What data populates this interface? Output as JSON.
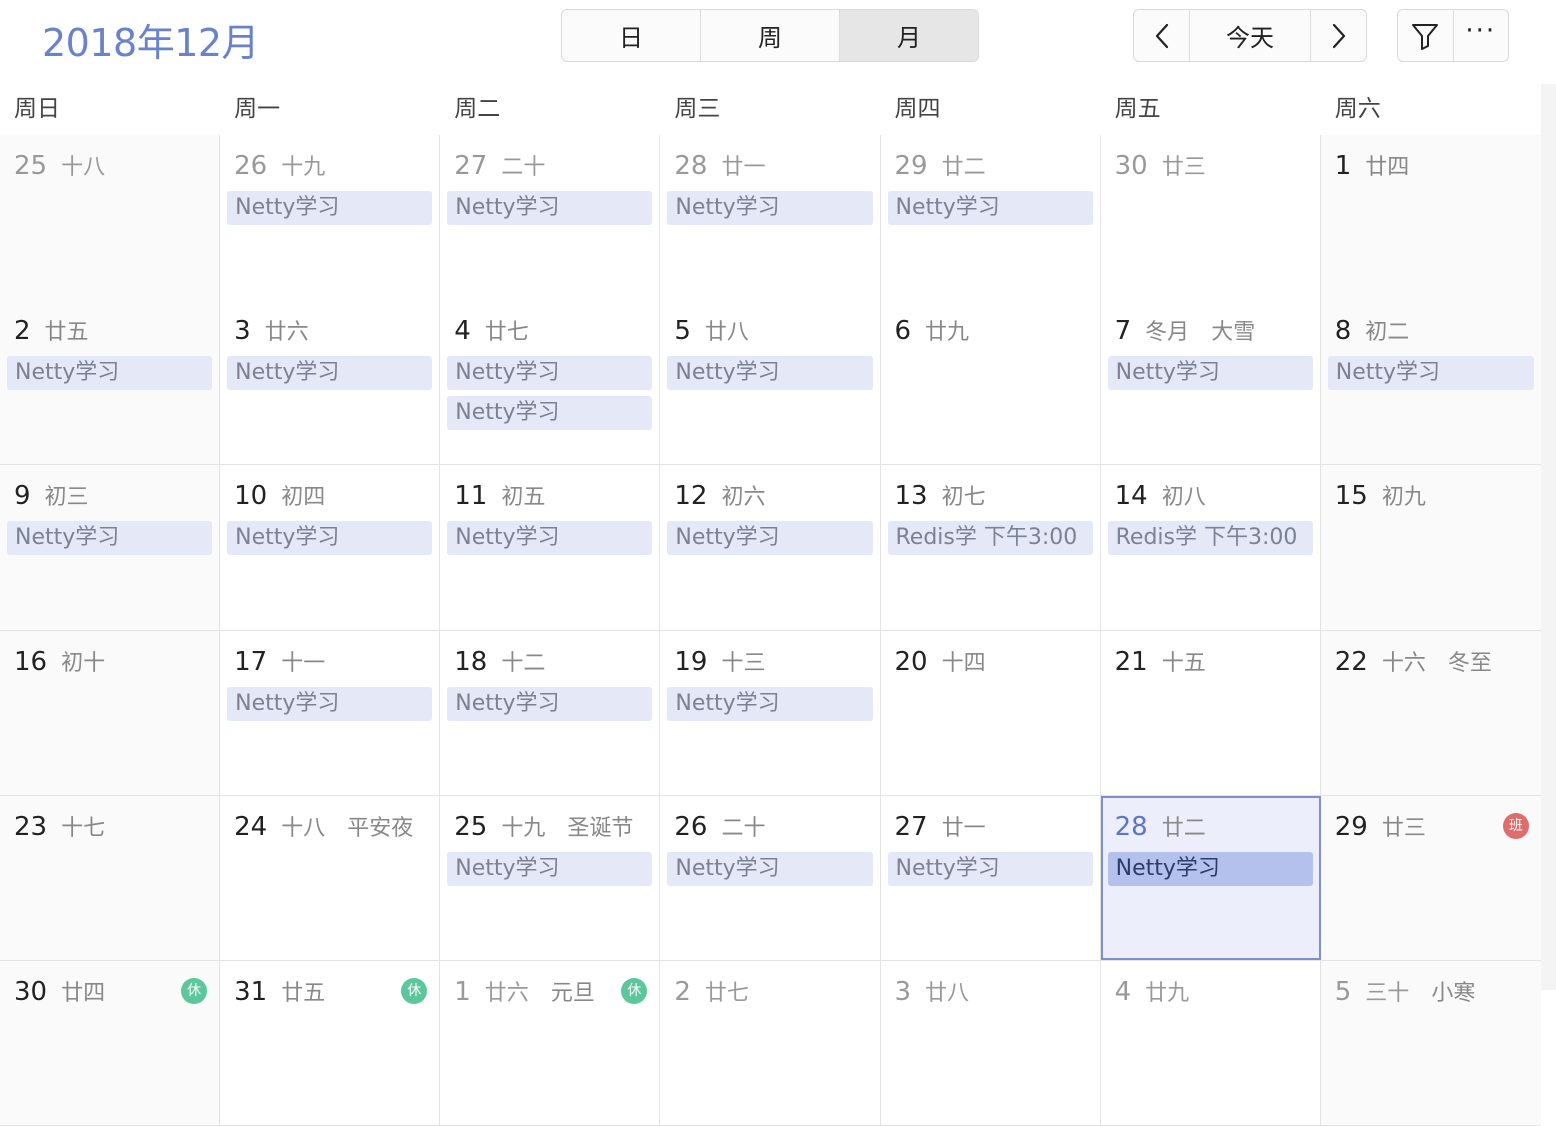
{
  "header": {
    "title": "2018年12月",
    "view_tabs": [
      {
        "label": "日",
        "active": false
      },
      {
        "label": "周",
        "active": false
      },
      {
        "label": "月",
        "active": true
      }
    ],
    "today_label": "今天",
    "more_label": "···"
  },
  "weekdays": [
    "周日",
    "周一",
    "周二",
    "周三",
    "周四",
    "周五",
    "周六"
  ],
  "weeks": [
    [
      {
        "day": "25",
        "lunar": "十八",
        "other": true,
        "events": []
      },
      {
        "day": "26",
        "lunar": "十九",
        "other": true,
        "events": [
          "Netty学习"
        ]
      },
      {
        "day": "27",
        "lunar": "二十",
        "other": true,
        "events": [
          "Netty学习"
        ]
      },
      {
        "day": "28",
        "lunar": "廿一",
        "other": true,
        "events": [
          "Netty学习"
        ]
      },
      {
        "day": "29",
        "lunar": "廿二",
        "other": true,
        "events": [
          "Netty学习"
        ]
      },
      {
        "day": "30",
        "lunar": "廿三",
        "other": true,
        "events": []
      },
      {
        "day": "1",
        "lunar": "廿四",
        "events": []
      }
    ],
    [
      {
        "day": "2",
        "lunar": "廿五",
        "events": [
          "Netty学习"
        ]
      },
      {
        "day": "3",
        "lunar": "廿六",
        "events": [
          "Netty学习"
        ]
      },
      {
        "day": "4",
        "lunar": "廿七",
        "events": [
          "Netty学习",
          "Netty学习"
        ]
      },
      {
        "day": "5",
        "lunar": "廿八",
        "events": [
          "Netty学习"
        ]
      },
      {
        "day": "6",
        "lunar": "廿九",
        "events": []
      },
      {
        "day": "7",
        "lunar": "冬月",
        "festival": "大雪",
        "events": [
          "Netty学习"
        ]
      },
      {
        "day": "8",
        "lunar": "初二",
        "events": [
          "Netty学习"
        ]
      }
    ],
    [
      {
        "day": "9",
        "lunar": "初三",
        "events": [
          "Netty学习"
        ]
      },
      {
        "day": "10",
        "lunar": "初四",
        "events": [
          "Netty学习"
        ]
      },
      {
        "day": "11",
        "lunar": "初五",
        "events": [
          "Netty学习"
        ]
      },
      {
        "day": "12",
        "lunar": "初六",
        "events": [
          "Netty学习"
        ]
      },
      {
        "day": "13",
        "lunar": "初七",
        "events": [
          "Redis学 下午3:00"
        ]
      },
      {
        "day": "14",
        "lunar": "初八",
        "events": [
          "Redis学 下午3:00"
        ]
      },
      {
        "day": "15",
        "lunar": "初九",
        "events": []
      }
    ],
    [
      {
        "day": "16",
        "lunar": "初十",
        "events": []
      },
      {
        "day": "17",
        "lunar": "十一",
        "events": [
          "Netty学习"
        ]
      },
      {
        "day": "18",
        "lunar": "十二",
        "events": [
          "Netty学习"
        ]
      },
      {
        "day": "19",
        "lunar": "十三",
        "events": [
          "Netty学习"
        ]
      },
      {
        "day": "20",
        "lunar": "十四",
        "events": []
      },
      {
        "day": "21",
        "lunar": "十五",
        "events": []
      },
      {
        "day": "22",
        "lunar": "十六",
        "festival": "冬至",
        "events": []
      }
    ],
    [
      {
        "day": "23",
        "lunar": "十七",
        "events": []
      },
      {
        "day": "24",
        "lunar": "十八",
        "festival": "平安夜",
        "events": []
      },
      {
        "day": "25",
        "lunar": "十九",
        "festival": "圣诞节",
        "events": [
          "Netty学习"
        ]
      },
      {
        "day": "26",
        "lunar": "二十",
        "events": [
          "Netty学习"
        ]
      },
      {
        "day": "27",
        "lunar": "廿一",
        "events": [
          "Netty学习"
        ]
      },
      {
        "day": "28",
        "lunar": "廿二",
        "today": true,
        "events": [
          "Netty学习"
        ],
        "selected": true
      },
      {
        "day": "29",
        "lunar": "廿三",
        "badge": "班",
        "badge_type": "ban",
        "events": []
      }
    ],
    [
      {
        "day": "30",
        "lunar": "廿四",
        "badge": "休",
        "badge_type": "xiu",
        "events": []
      },
      {
        "day": "31",
        "lunar": "廿五",
        "badge": "休",
        "badge_type": "xiu",
        "events": []
      },
      {
        "day": "1",
        "lunar": "廿六",
        "festival": "元旦",
        "badge": "休",
        "badge_type": "xiu",
        "other": true,
        "events": []
      },
      {
        "day": "2",
        "lunar": "廿七",
        "other": true,
        "events": []
      },
      {
        "day": "3",
        "lunar": "廿八",
        "other": true,
        "events": []
      },
      {
        "day": "4",
        "lunar": "廿九",
        "other": true,
        "events": []
      },
      {
        "day": "5",
        "lunar": "三十",
        "festival": "小寒",
        "other": true,
        "events": []
      }
    ]
  ],
  "colors": {
    "accent": "#6a82cc",
    "event_bg": "#e4e8f7",
    "event_selected_bg": "#b4c1ec",
    "today_bg": "#eceffb",
    "badge_ban": "#e06c6c",
    "badge_xiu": "#5cc79a"
  }
}
